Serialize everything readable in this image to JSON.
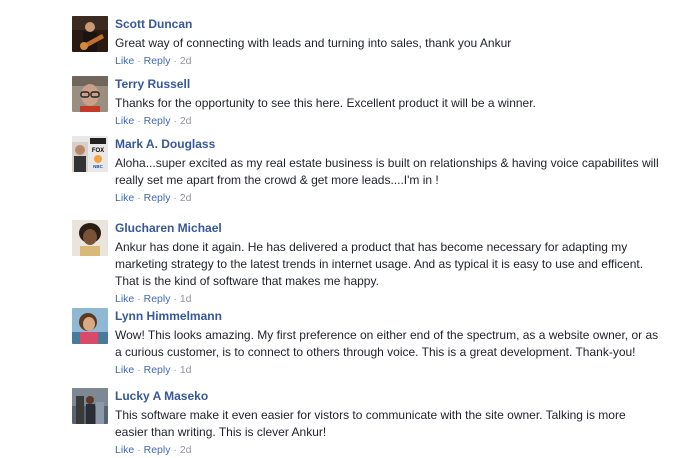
{
  "comments": [
    {
      "name": "Scott Duncan",
      "text": "Great way of connecting with leads and turning into sales, thank you Ankur",
      "like": "Like",
      "reply": "Reply",
      "sep1": "·",
      "sep2": "·",
      "time": "2d"
    },
    {
      "name": "Terry Russell",
      "text": "Thanks for the opportunity to see this here. Excellent product it will be a winner.",
      "like": "Like",
      "reply": "Reply",
      "sep1": "·",
      "sep2": "·",
      "time": "2d"
    },
    {
      "name": "Mark A. Douglass",
      "text": "Aloha...super excited as my real estate business is built on relationships & having voice capabilites will really set me apart from the crowd & get more leads....I'm in !",
      "like": "Like",
      "reply": "Reply",
      "sep1": "·",
      "sep2": "·",
      "time": "2d"
    },
    {
      "name": "Glucharen Michael",
      "text": "Ankur has done it again. He has delivered a product that has become necessary for adapting my marketing strategy to the latest trends in internet usage. And as typical it is easy to use and efficent. That is the kind of software that makes me happy.",
      "like": "Like",
      "reply": "Reply",
      "sep1": "·",
      "sep2": "·",
      "time": "1d"
    },
    {
      "name": "Lynn Himmelmann",
      "text": "Wow! This looks amazing. My first preference on either end of the spectrum, as a website owner, or as a curious customer, is to connect to others through voice. This is a great development. Thank-you!",
      "like": "Like",
      "reply": "Reply",
      "sep1": "·",
      "sep2": "·",
      "time": "1d"
    },
    {
      "name": "Lucky A Maseko",
      "text": "This software make it even easier for vistors to communicate with the site owner. Talking is more easier than writing. This is clever Ankur!",
      "like": "Like",
      "reply": "Reply",
      "sep1": "·",
      "sep2": "·",
      "time": "2d"
    }
  ],
  "avatar_logos": {
    "fox": "FOX",
    "nbc": "NBC"
  }
}
